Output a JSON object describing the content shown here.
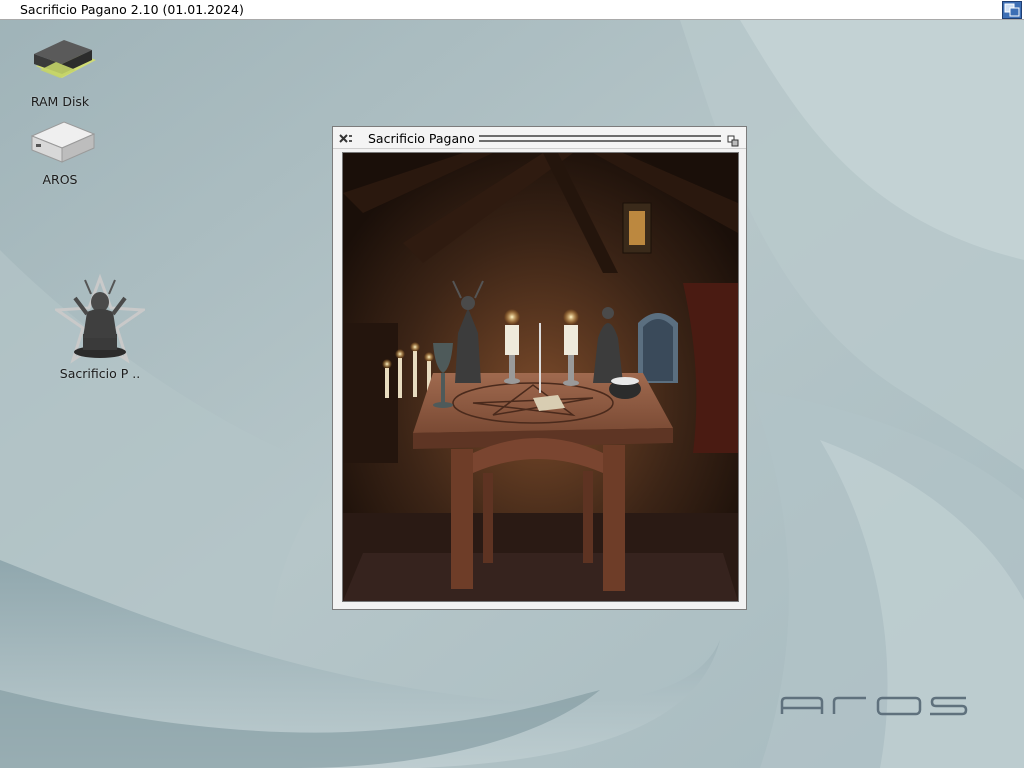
{
  "screen": {
    "title": "Sacrificio Pagano 2.10 (01.01.2024)",
    "depth_gadget": "screen-depth-icon"
  },
  "desktop": {
    "icons": [
      {
        "label": "RAM Disk",
        "icon": "ram-disk-icon"
      },
      {
        "label": "AROS",
        "icon": "drive-icon"
      },
      {
        "label": "Sacrificio P ..",
        "icon": "pagan-statue-icon"
      }
    ],
    "logo_text": "aros"
  },
  "window": {
    "title": "Sacrificio Pagano",
    "close_gadget": "close-icon",
    "depth_gadget": "depth-icon",
    "content": "ritual-altar-scene"
  },
  "colors": {
    "desktop_bg": "#aebfc3",
    "window_bg": "#f2f2f2",
    "screen_depth": "#3d6fb5"
  }
}
